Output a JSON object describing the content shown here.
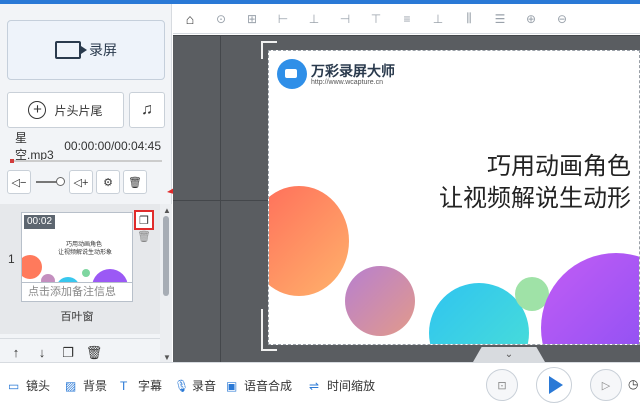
{
  "left": {
    "record_label": "录屏",
    "title_tail_label": "片头片尾",
    "audio_filename": "星空.mp3",
    "audio_time": "00:00:00/00:04:45",
    "clip": {
      "index": "1",
      "time": "00:02",
      "thumb_line1": "巧用动画角色",
      "thumb_line2": "让视频解说生动形象",
      "note_placeholder": "点击添加备注信息",
      "transition_label": "百叶窗"
    }
  },
  "slide": {
    "logo_text": "万彩录屏大师",
    "logo_url": "http://www.wcapture.cn",
    "headline_line1": "巧用动画角色",
    "headline_line2": "让视频解说生动形"
  },
  "bottom": {
    "camera": "镜头",
    "background": "背景",
    "subtitle": "字幕",
    "record_audio": "录音",
    "tts": "语音合成",
    "time_scale": "时间缩放"
  },
  "colors": {
    "accent": "#2a79d6",
    "highlight": "#e02b2b"
  }
}
